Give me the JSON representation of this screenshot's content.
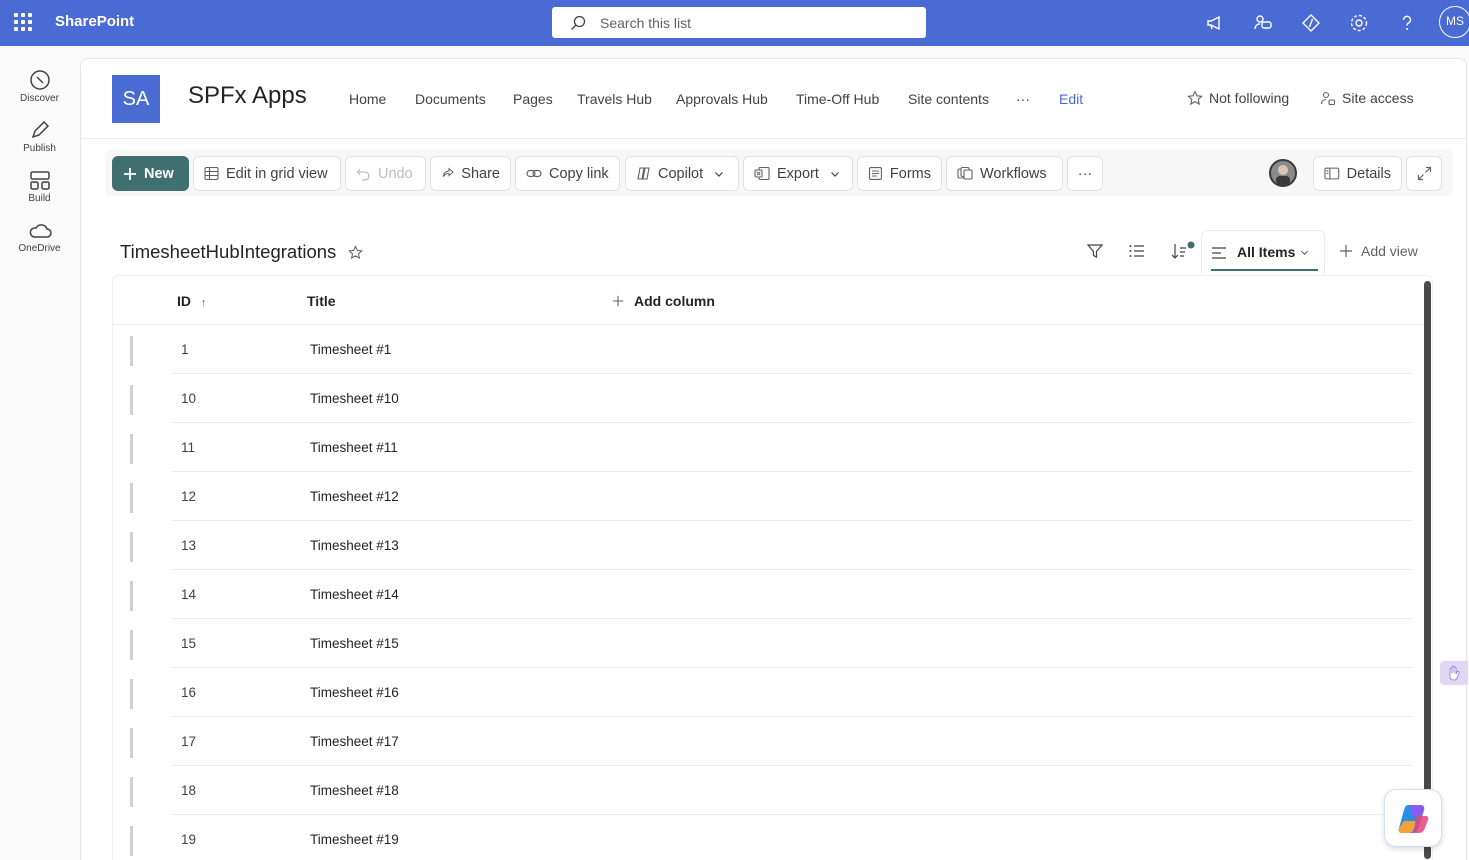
{
  "suite": {
    "brand": "SharePoint",
    "search_placeholder": "Search this list",
    "user_initials": "MS"
  },
  "appbar": [
    {
      "label": "Discover"
    },
    {
      "label": "Publish"
    },
    {
      "label": "Build"
    },
    {
      "label": "OneDrive"
    }
  ],
  "site": {
    "logo": "SA",
    "title": "SPFx Apps",
    "nav": [
      "Home",
      "Documents",
      "Pages",
      "Travels Hub",
      "Approvals Hub",
      "Time-Off Hub",
      "Site contents",
      "···",
      "Edit"
    ],
    "follow": "Not following",
    "access": "Site access"
  },
  "commands": {
    "new": "New",
    "grid": "Edit in grid view",
    "undo": "Undo",
    "share": "Share",
    "copy": "Copy link",
    "copilot": "Copilot",
    "export": "Export",
    "forms": "Forms",
    "workflows": "Workflows",
    "more": "···",
    "details": "Details"
  },
  "list": {
    "title": "TimesheetHubIntegrations",
    "view": "All Items",
    "add_view": "Add view",
    "columns": {
      "id": "ID",
      "id_sort": "↑",
      "title": "Title",
      "add": "Add column"
    },
    "rows": [
      {
        "id": "1",
        "title": "Timesheet #1"
      },
      {
        "id": "10",
        "title": "Timesheet #10"
      },
      {
        "id": "11",
        "title": "Timesheet #11"
      },
      {
        "id": "12",
        "title": "Timesheet #12"
      },
      {
        "id": "13",
        "title": "Timesheet #13"
      },
      {
        "id": "14",
        "title": "Timesheet #14"
      },
      {
        "id": "15",
        "title": "Timesheet #15"
      },
      {
        "id": "16",
        "title": "Timesheet #16"
      },
      {
        "id": "17",
        "title": "Timesheet #17"
      },
      {
        "id": "18",
        "title": "Timesheet #18"
      },
      {
        "id": "19",
        "title": "Timesheet #19"
      }
    ]
  },
  "colors": {
    "suitebar": "#4a6bd3",
    "accent": "#3f6f6e"
  }
}
